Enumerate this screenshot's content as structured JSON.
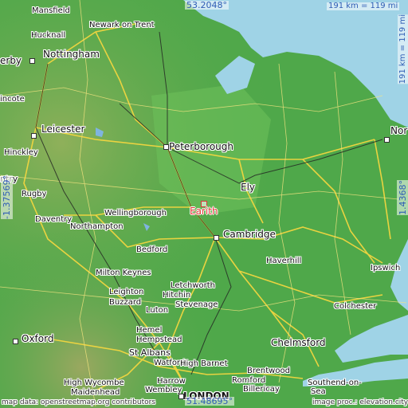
{
  "map": {
    "highlight": {
      "name": "Earith",
      "color": "#e23b3b"
    },
    "cities": {
      "mansfield": "Mansfield",
      "hucknall": "Hucknall",
      "derby": "erby",
      "nottingham": "Nottingham",
      "newark": "Newark on Trent",
      "lincote": "incote",
      "leicester": "Leicester",
      "hinckley": "Hinckley",
      "coventry": "ntry",
      "rugby": "Rugby",
      "daventry": "Daventry",
      "northampton": "Northampton",
      "wellingborough": "Wellingborough",
      "peterborough": "Peterborough",
      "ely": "Ely",
      "cambridge": "Cambridge",
      "bedford": "Bedford",
      "milton_keynes": "Milton Keynes",
      "leighton_buzzard_1": "Leighton",
      "leighton_buzzard_2": "Buzzard",
      "letchworth": "Letchworth",
      "hitchin": "Hitchin",
      "stevenage": "Stevenage",
      "luton": "Luton",
      "haverhill": "Haverhill",
      "ipswich": "Ipswich",
      "colchester": "Colchester",
      "chelmsford": "Chelmsford",
      "hemel_1": "Hemel",
      "hemel_2": "Hempstead",
      "st_albans": "St Albans",
      "oxford": "Oxford",
      "watford": "Watford",
      "high_barnet": "High Barnet",
      "high_wycombe": "High Wycombe",
      "maidenhead": "Maidenhead",
      "harrow": "Harrow",
      "wembley": "Wembley",
      "london": "LONDON",
      "romford": "Romford",
      "billericay": "Billericay",
      "brentwood": "Brentwood",
      "southend_1": "Southend-on-",
      "southend_2": "Sea",
      "norwich": "Nor"
    },
    "coords": {
      "top_lat": "53.2048°",
      "bottom_lat": "51.48695°",
      "left_lon": "-1.37569°",
      "right_lon": "1.4368°",
      "scale_h": "191 km = 119 mi",
      "scale_v": "191 km = 119 mi"
    },
    "credits": {
      "left": "map data: openstreetmap.org contributors",
      "right": "image proc.: elevation.city"
    },
    "colors": {
      "land": "#4fa84a",
      "sea": "#9fd3e6",
      "road": "#f2d640",
      "coord": "#2f5db5"
    }
  }
}
